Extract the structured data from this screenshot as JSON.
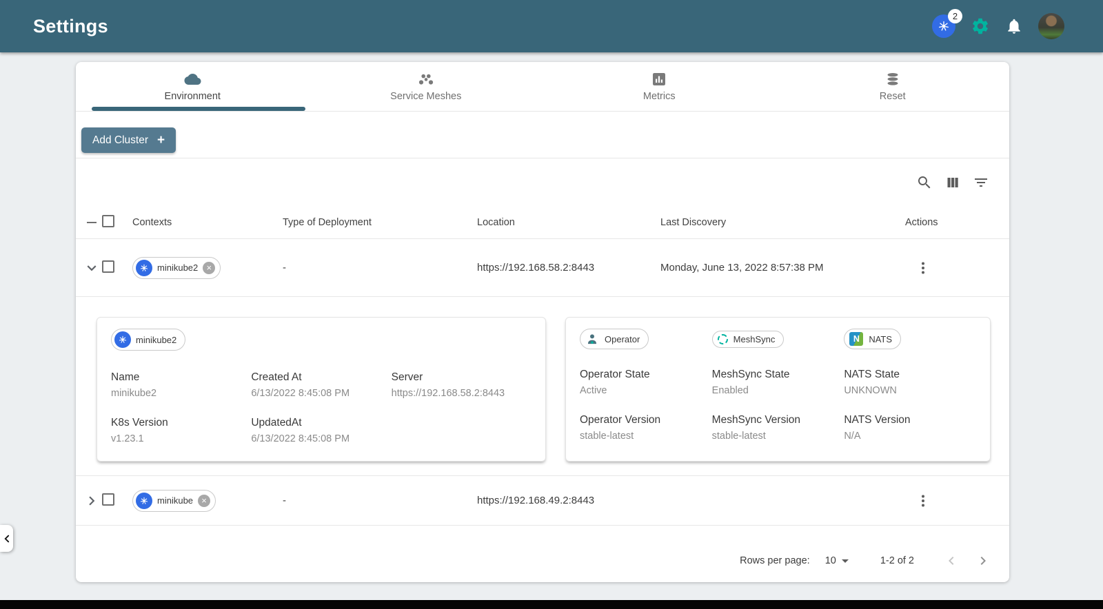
{
  "colors": {
    "header": "#396679",
    "accent_green": "#00B39F",
    "k8s_blue": "#326CE5",
    "button": "#557A90"
  },
  "header": {
    "title": "Settings",
    "k8s_badge_count": "2"
  },
  "tabs": [
    {
      "label": "Environment"
    },
    {
      "label": "Service Meshes"
    },
    {
      "label": "Metrics"
    },
    {
      "label": "Reset"
    }
  ],
  "actions": {
    "add_cluster_label": "Add Cluster",
    "add_cluster_plus": "+"
  },
  "table": {
    "columns": [
      "Contexts",
      "Type of Deployment",
      "Location",
      "Last Discovery",
      "Actions"
    ],
    "rows": [
      {
        "context": "minikube2",
        "type_of_deployment": "-",
        "location": "https://192.168.58.2:8443",
        "last_discovery": "Monday, June 13, 2022 8:57:38 PM"
      },
      {
        "context": "minikube",
        "type_of_deployment": "-",
        "location": "https://192.168.49.2:8443",
        "last_discovery": ""
      }
    ]
  },
  "detail": {
    "chip_label": "minikube2",
    "cluster_fields": [
      {
        "label": "Name",
        "value": "minikube2"
      },
      {
        "label": "Created At",
        "value": "6/13/2022 8:45:08 PM"
      },
      {
        "label": "Server",
        "value": "https://192.168.58.2:8443"
      },
      {
        "label": "K8s Version",
        "value": "v1.23.1"
      },
      {
        "label": "UpdatedAt",
        "value": "6/13/2022 8:45:08 PM"
      }
    ],
    "services": [
      {
        "label": "Operator"
      },
      {
        "label": "MeshSync"
      },
      {
        "label": "NATS"
      }
    ],
    "nats_icon_letter": "N",
    "service_fields": [
      {
        "label": "Operator State",
        "value": "Active"
      },
      {
        "label": "MeshSync State",
        "value": "Enabled"
      },
      {
        "label": "NATS State",
        "value": "UNKNOWN"
      },
      {
        "label": "Operator Version",
        "value": "stable-latest"
      },
      {
        "label": "MeshSync Version",
        "value": "stable-latest"
      },
      {
        "label": "NATS Version",
        "value": "N/A"
      }
    ]
  },
  "pagination": {
    "rows_per_page_label": "Rows per page:",
    "page_size": "10",
    "range": "1-2 of 2"
  }
}
